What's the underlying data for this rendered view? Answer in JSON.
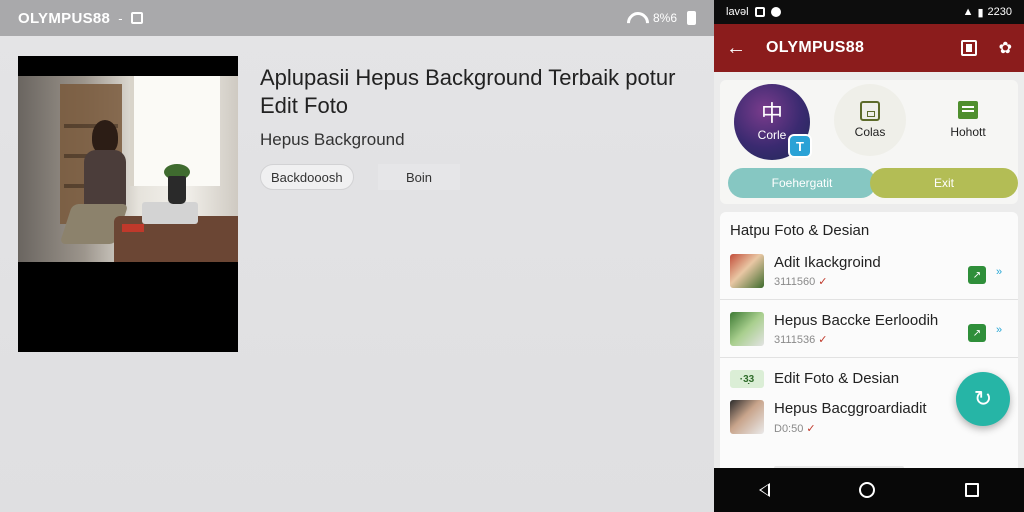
{
  "left": {
    "status_bar": {
      "brand": "OLYMPUS88",
      "separator": "-",
      "battery_text": "8%6"
    },
    "headline": "Aplupasii Hepus Background Terbaik potur Edit Foto",
    "subheadline": "Hepus Background",
    "primary_button": "Backdooosh",
    "secondary_button": "Boin"
  },
  "phone": {
    "status_bar": {
      "left_text": "lavəl",
      "time": "2230"
    },
    "appbar": {
      "title": "OLYMPUS88",
      "back_icon": "arrow-left-icon"
    },
    "quick_actions": [
      {
        "label": "Corle",
        "glyph": "中"
      },
      {
        "label": "Colas"
      },
      {
        "label": "Hohott"
      }
    ],
    "badge_glyph": "T",
    "pills": {
      "left": "Foehergatit",
      "right": "Exit"
    },
    "list": {
      "title": "Hatpu Foto & Desian",
      "items": [
        {
          "title": "Adit Ikackgroind",
          "meta": "3111560"
        },
        {
          "title": "Hepus Baccke Eerloodih",
          "meta": "3111536"
        }
      ],
      "group": {
        "badge": "·3̣3",
        "title": "Edit Foto & Desian",
        "sub": "Hepus Bacggroardiadit",
        "meta": "D0:50"
      }
    },
    "colors": {
      "appbar": "#8b1c1c",
      "fab": "#26b5a6",
      "pill_left": "#86c7c2",
      "pill_right": "#b3bd55"
    }
  }
}
